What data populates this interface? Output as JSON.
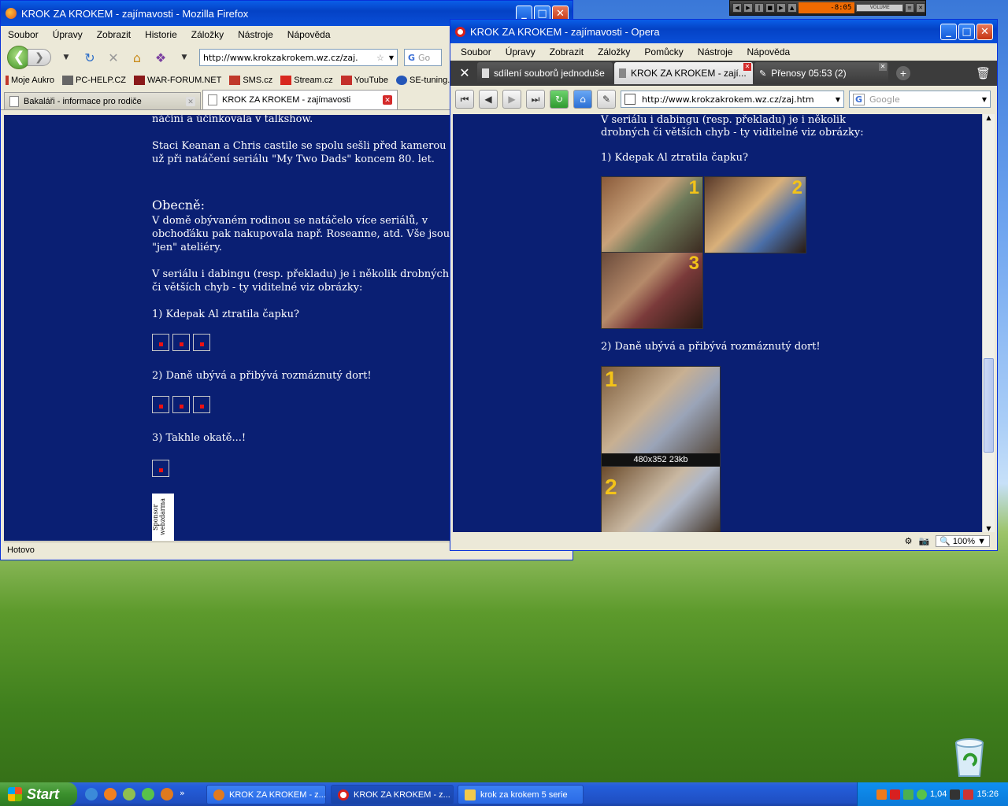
{
  "firefox": {
    "title": "KROK ZA KROKEM - zajímavosti - Mozilla Firefox",
    "menu": [
      "Soubor",
      "Úpravy",
      "Zobrazit",
      "Historie",
      "Záložky",
      "Nástroje",
      "Nápověda"
    ],
    "url": "http://www.krokzakrokem.wz.cz/zaj.",
    "search_placeholder": "Go",
    "bookmarks": [
      "Moje Aukro",
      "PC-HELP.CZ",
      "WAR-FORUM.NET",
      "SMS.cz",
      "Stream.cz",
      "YouTube",
      "SE-tuning.cz"
    ],
    "tabs": [
      {
        "label": "Bakaláři - informace pro rodiče"
      },
      {
        "label": "KROK ZA KROKEM - zajímavosti"
      }
    ],
    "content": {
      "line_top": "náčiní a účinkovala v talkshow.",
      "para1_l1": "Staci Keanan a Chris castile se spolu sešli před kamerou",
      "para1_l2": "už při natáčení seriálu \"My Two Dads\" koncem 80. let.",
      "heading": "Obecně:",
      "para2_l1": "V domě obývaném rodinou se natáčelo více seriálů, v",
      "para2_l2": "obchoďáku pak nakupovala např. Roseanne, atd. Vše jsou",
      "para2_l3": "\"jen\" ateliéry.",
      "para3_l1": "V seriálu i dabingu (resp. překladu) je i několik drobných",
      "para3_l2": "či větších chyb - ty viditelné viz obrázky:",
      "q1": "1) Kdepak Al ztratila čapku?",
      "q2": "2) Daně ubývá a přibývá rozmáznutý dort!",
      "q3": "3) Takhle okatě...!",
      "sponsor": "Sponsor webzdarma"
    },
    "status": "Hotovo"
  },
  "opera": {
    "title": "KROK ZA KROKEM - zajímavosti - Opera",
    "menu": [
      "Soubor",
      "Úpravy",
      "Zobrazit",
      "Záložky",
      "Pomůcky",
      "Nástroje",
      "Nápověda"
    ],
    "tabs": [
      {
        "label": "sdílení souborů jednoduše"
      },
      {
        "label": "KROK ZA KROKEM - zají..."
      },
      {
        "label": "Přenosy 05:53 (2)"
      }
    ],
    "url": "http://www.krokzakrokem.wz.cz/zaj.htm",
    "search_placeholder": "Google",
    "content": {
      "p1": "V seriálu i dabingu (resp. překladu) je i několik",
      "p2": "drobných či větších chyb - ty viditelné viz obrázky:",
      "q1": "1) Kdepak Al ztratila čapku?",
      "q2": "2) Daně ubývá a přibývá rozmáznutý dort!",
      "img_caption": "480x352 23kb",
      "nums": [
        "1",
        "2",
        "3",
        "1",
        "2"
      ]
    },
    "zoom": "100%"
  },
  "winamp": {
    "time": "-8:05",
    "vol_label": "VOLUME"
  },
  "taskbar": {
    "start": "Start",
    "tasks": [
      "KROK ZA KROKEM - z...",
      "KROK ZA KROKEM - z...",
      "krok za krokem 5 serie"
    ],
    "tray_text": "1,04",
    "clock": "15:26"
  }
}
